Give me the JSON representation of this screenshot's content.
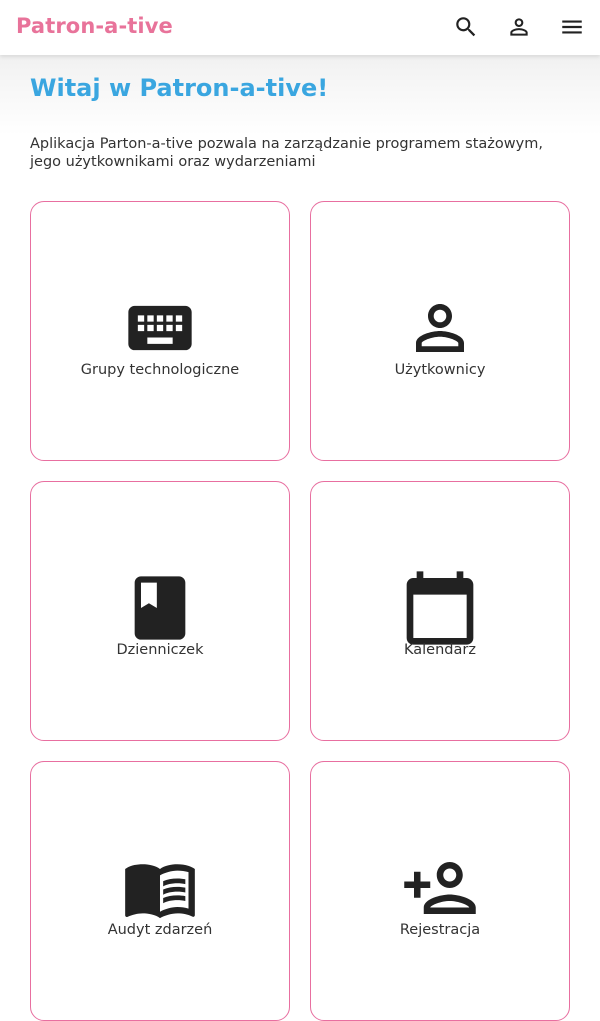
{
  "app": {
    "brand": "Patron-a-tive"
  },
  "nav": {
    "icons": [
      "search-icon",
      "person-icon",
      "menu-icon"
    ]
  },
  "page": {
    "title": "Witaj w Patron-a-tive!",
    "intro": "Aplikacja Parton-a-tive pozwala na zarządzanie programem stażowym, jego użytkownikami oraz wydarzeniami"
  },
  "tiles": [
    {
      "label": "Grupy technologiczne",
      "icon": "keyboard-icon"
    },
    {
      "label": "Użytkownicy",
      "icon": "person-icon"
    },
    {
      "label": "Dzienniczek",
      "icon": "book-icon"
    },
    {
      "label": "Kalendarz",
      "icon": "calendar-icon"
    },
    {
      "label": "Audyt zdarzeń",
      "icon": "open-book-icon"
    },
    {
      "label": "Rejestracja",
      "icon": "person-add-icon"
    }
  ],
  "colors": {
    "brand": "#e8739a",
    "title": "#3aa6e0",
    "tile_border": "#e86fa0",
    "icon": "#222222"
  }
}
